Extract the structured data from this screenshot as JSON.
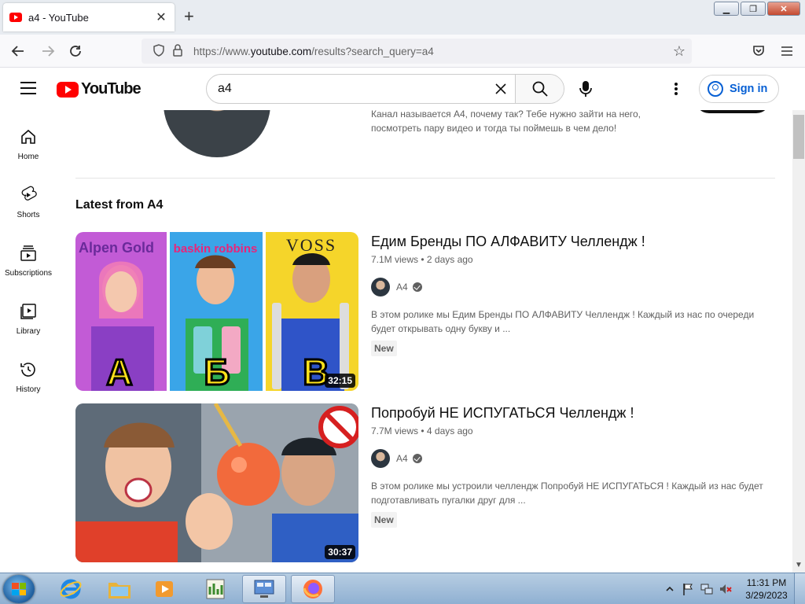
{
  "browser": {
    "tab_title": "a4 - YouTube",
    "url_prefix": "https://www.",
    "url_domain": "youtube.com",
    "url_path": "/results?search_query=a4"
  },
  "youtube": {
    "logo_text": "YouTube",
    "search_query": "a4",
    "sign_in": "Sign in",
    "accent": "#ff0000",
    "link_color": "#065fd4"
  },
  "sidebar": {
    "items": [
      {
        "label": "Home",
        "icon": "home-icon"
      },
      {
        "label": "Shorts",
        "icon": "shorts-icon"
      },
      {
        "label": "Subscriptions",
        "icon": "subscriptions-icon"
      },
      {
        "label": "Library",
        "icon": "library-icon"
      },
      {
        "label": "History",
        "icon": "history-icon"
      }
    ]
  },
  "channel": {
    "description_line1": "Канал называется А4, почему так? Тебе нужно зайти на него,",
    "description_line2": "посмотреть пару видео и тогда ты поймешь в чем дело!"
  },
  "section_title": "Latest from A4",
  "videos": [
    {
      "title": "Едим Бренды ПО АЛФАВИТУ Челлендж !",
      "meta": "7.1M views • 2 days ago",
      "channel": "A4",
      "description": "В этом ролике мы Едим Бренды ПО АЛФАВИТУ Челлендж ! Каждый из нас по очереди будет открывать одну букву и ...",
      "badge": "New",
      "duration": "32:15",
      "thumb_text": [
        "Alpen Gold",
        "baskin robbins",
        "VOSS",
        "А",
        "Б",
        "В"
      ]
    },
    {
      "title": "Попробуй НЕ ИСПУГАТЬСЯ Челлендж !",
      "meta": "7.7M views • 4 days ago",
      "channel": "A4",
      "description": "В этом ролике мы устроили челлендж Попробуй НЕ ИСПУГАТЬСЯ ! Каждый из нас будет подготавливать пугалки друг для ...",
      "badge": "New",
      "duration": "30:37"
    }
  ],
  "taskbar": {
    "time": "11:31 PM",
    "date": "3/29/2023"
  }
}
